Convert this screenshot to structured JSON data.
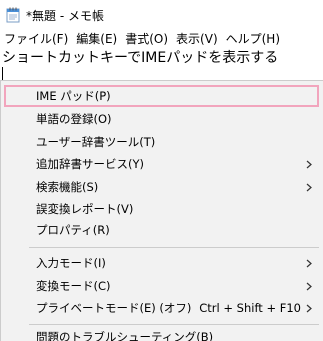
{
  "window": {
    "title": "*無題 - メモ帳"
  },
  "menubar": {
    "items": [
      {
        "label": "ファイル(F)"
      },
      {
        "label": "編集(E)"
      },
      {
        "label": "書式(O)"
      },
      {
        "label": "表示(V)"
      },
      {
        "label": "ヘルプ(H)"
      }
    ]
  },
  "editor": {
    "text": "ショートカットキーでIMEパッドを表示する"
  },
  "context_menu": {
    "items": [
      {
        "label": "IME パッド(P)",
        "submenu": false,
        "shortcut": "",
        "highlighted": true
      },
      {
        "label": "単語の登録(O)",
        "submenu": false,
        "shortcut": ""
      },
      {
        "label": "ユーザー辞書ツール(T)",
        "submenu": false,
        "shortcut": ""
      },
      {
        "label": "追加辞書サービス(Y)",
        "submenu": true,
        "shortcut": ""
      },
      {
        "label": "検索機能(S)",
        "submenu": true,
        "shortcut": ""
      },
      {
        "label": "誤変換レポート(V)",
        "submenu": false,
        "shortcut": ""
      },
      {
        "label": "プロパティ(R)",
        "submenu": false,
        "shortcut": ""
      },
      {
        "label": "入力モード(I)",
        "submenu": true,
        "shortcut": ""
      },
      {
        "label": "変換モード(C)",
        "submenu": true,
        "shortcut": ""
      },
      {
        "label": "プライベートモード(E) (オフ)",
        "submenu": true,
        "shortcut": "Ctrl + Shift + F10"
      },
      {
        "label": "問題のトラブルシューティング(B)",
        "submenu": false,
        "shortcut": ""
      }
    ],
    "highlight_color": "#f2a5bd"
  },
  "icons": {
    "app": "notepad-icon",
    "submenu": "chevron-right-icon"
  }
}
